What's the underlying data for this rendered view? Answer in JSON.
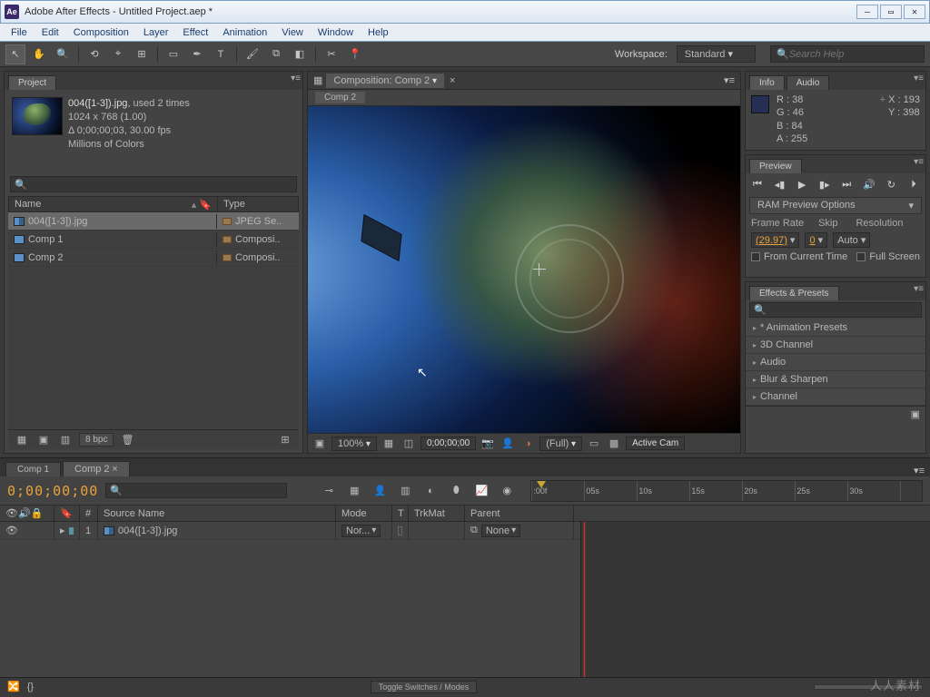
{
  "window": {
    "title": "Adobe After Effects - Untitled Project.aep *",
    "app_icon_label": "Ae"
  },
  "menu": [
    "File",
    "Edit",
    "Composition",
    "Layer",
    "Effect",
    "Animation",
    "View",
    "Window",
    "Help"
  ],
  "toolbar": {
    "workspace_label": "Workspace:",
    "workspace_value": "Standard",
    "search_help_placeholder": "Search Help"
  },
  "project": {
    "tab": "Project",
    "selected_name": "004([1-3]).jpg",
    "selected_used": ", used 2 times",
    "meta_dims": "1024 x 768 (1.00)",
    "meta_dur": "Δ 0;00;00;03, 30.00 fps",
    "meta_colors": "Millions of Colors",
    "col_name": "Name",
    "col_type": "Type",
    "rows": [
      {
        "name": "004([1-3]).jpg",
        "type": "JPEG Se..",
        "kind": "seq",
        "sel": true
      },
      {
        "name": "Comp 1",
        "type": "Composi..",
        "kind": "comp",
        "sel": false
      },
      {
        "name": "Comp 2",
        "type": "Composi..",
        "kind": "comp",
        "sel": false
      }
    ],
    "bpc": "8 bpc"
  },
  "composition": {
    "tab_label": "Composition: Comp 2",
    "inner_tab": "Comp 2",
    "zoom": "100%",
    "time": "0;00;00;00",
    "res": "(Full)",
    "camera": "Active Cam"
  },
  "info": {
    "tab_info": "Info",
    "tab_audio": "Audio",
    "r": "R : 38",
    "g": "G : 46",
    "b": "B : 84",
    "a": "A : 255",
    "x": "X : 193",
    "y": "Y : 398"
  },
  "preview": {
    "tab": "Preview",
    "ram_label": "RAM Preview Options",
    "frame_rate_label": "Frame Rate",
    "frame_rate_val": "(29.97)",
    "skip_label": "Skip",
    "skip_val": "0",
    "res_label": "Resolution",
    "res_val": "Auto",
    "from_current": "From Current Time",
    "full_screen": "Full Screen"
  },
  "effects": {
    "tab": "Effects & Presets",
    "items": [
      "* Animation Presets",
      "3D Channel",
      "Audio",
      "Blur & Sharpen",
      "Channel"
    ]
  },
  "timeline": {
    "tabs": [
      "Comp 1",
      "Comp 2"
    ],
    "active_tab": 1,
    "time": "0;00;00;00",
    "ruler": [
      ":00f",
      "05s",
      "10s",
      "15s",
      "20s",
      "25s",
      "30s"
    ],
    "col_index": "#",
    "col_source": "Source Name",
    "col_mode": "Mode",
    "col_t": "T",
    "col_trkmat": "TrkMat",
    "col_parent": "Parent",
    "layer_index": "1",
    "layer_name": "004([1-3]).jpg",
    "layer_mode": "Nor...",
    "layer_parent": "None",
    "toggle_label": "Toggle Switches / Modes"
  },
  "watermark": "人人素材"
}
